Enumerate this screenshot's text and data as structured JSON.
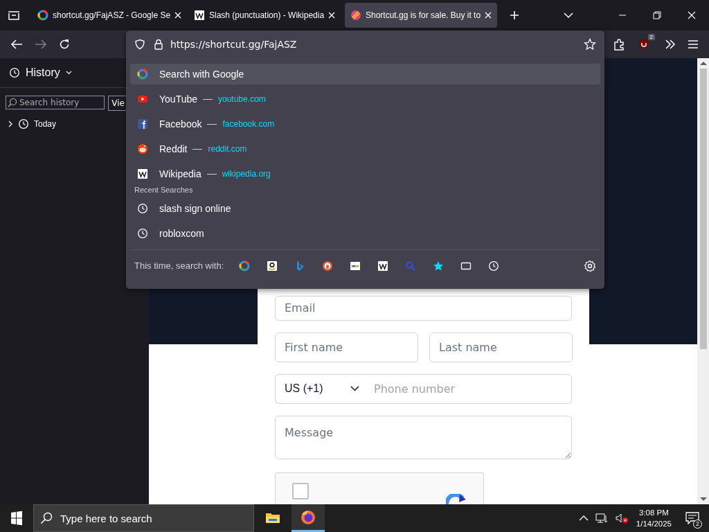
{
  "tabs": [
    {
      "title": "shortcut.gg/FajASZ - Google Se",
      "kind": "google",
      "selected": false
    },
    {
      "title": "Slash (punctuation) - Wikipedia",
      "kind": "wikipedia",
      "selected": false
    },
    {
      "title": "Shortcut.gg is for sale. Buy it to",
      "kind": "shortcut",
      "selected": true
    }
  ],
  "toolbar": {
    "forward_disabled": true,
    "extension_badge": "2"
  },
  "url_bar": {
    "value": "https://shortcut.gg/FajASZ"
  },
  "suggestions": [
    {
      "kind": "google",
      "title": "Search with Google",
      "selected": true
    },
    {
      "kind": "youtube",
      "title": "YouTube",
      "url": "youtube.com",
      "selected": false
    },
    {
      "kind": "facebook",
      "title": "Facebook",
      "url": "facebook.com",
      "selected": false
    },
    {
      "kind": "reddit",
      "title": "Reddit",
      "url": "reddit.com",
      "selected": false
    },
    {
      "kind": "wikipedia",
      "title": "Wikipedia",
      "url": "wikipedia.org",
      "selected": false
    }
  ],
  "recent_searches": {
    "heading": "Recent Searches",
    "items": [
      "slash sign online",
      "robloxcom"
    ]
  },
  "search_with": {
    "label": "This time, search with:",
    "engines": [
      {
        "kind": "google"
      },
      {
        "kind": "amazon"
      },
      {
        "kind": "bing"
      },
      {
        "kind": "duckduckgo"
      },
      {
        "kind": "ebay"
      },
      {
        "kind": "wikipedia"
      },
      {
        "kind": "search"
      },
      {
        "kind": "bookmarks"
      },
      {
        "kind": "tabs"
      },
      {
        "kind": "history"
      }
    ]
  },
  "sidebar": {
    "title": "History",
    "search_placeholder": "Search history",
    "view_button": "Vie",
    "tree": [
      {
        "label": "Today",
        "expanded": false
      }
    ]
  },
  "form": {
    "email_placeholder": "Email",
    "first_name_placeholder": "First name",
    "last_name_placeholder": "Last name",
    "country": "US (+1)",
    "phone_placeholder": "Phone number",
    "message_placeholder": "Message",
    "captcha_checked": false
  },
  "taskbar": {
    "search_placeholder": "Type here to search",
    "apps": [
      {
        "kind": "explorer",
        "selected": false
      },
      {
        "kind": "firefox",
        "selected": true
      }
    ],
    "time": "3:08 PM",
    "date": "1/14/2025",
    "notifications": "2"
  }
}
